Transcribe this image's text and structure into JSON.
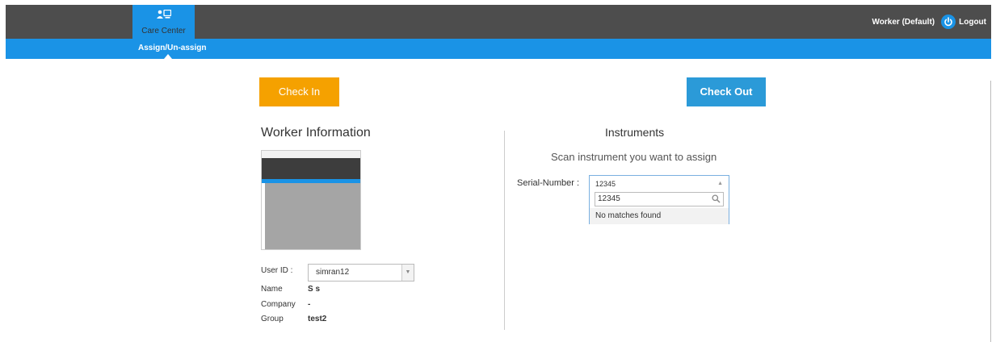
{
  "header": {
    "app_tab": "Care Center",
    "user_label": "Worker (Default)",
    "logout_label": "Logout",
    "subnav_label": "Assign/Un-assign"
  },
  "actions": {
    "check_in": "Check In",
    "check_out": "Check Out"
  },
  "worker": {
    "title": "Worker Information",
    "user_id_label": "User ID :",
    "user_id_value": "simran12",
    "name_label": "Name",
    "name_value": "S s",
    "company_label": "Company",
    "company_value": "-",
    "group_label": "Group",
    "group_value": "test2"
  },
  "instruments": {
    "title": "Instruments",
    "instruction": "Scan instrument you want to assign",
    "serial_label": "Serial-Number :",
    "selected_value": "12345",
    "search_value": "12345",
    "no_matches": "No matches found"
  },
  "colors": {
    "topbar": "#4d4d4d",
    "accent": "#1a93e6",
    "check_in": "#f5a100",
    "check_out": "#2b9ad8"
  }
}
